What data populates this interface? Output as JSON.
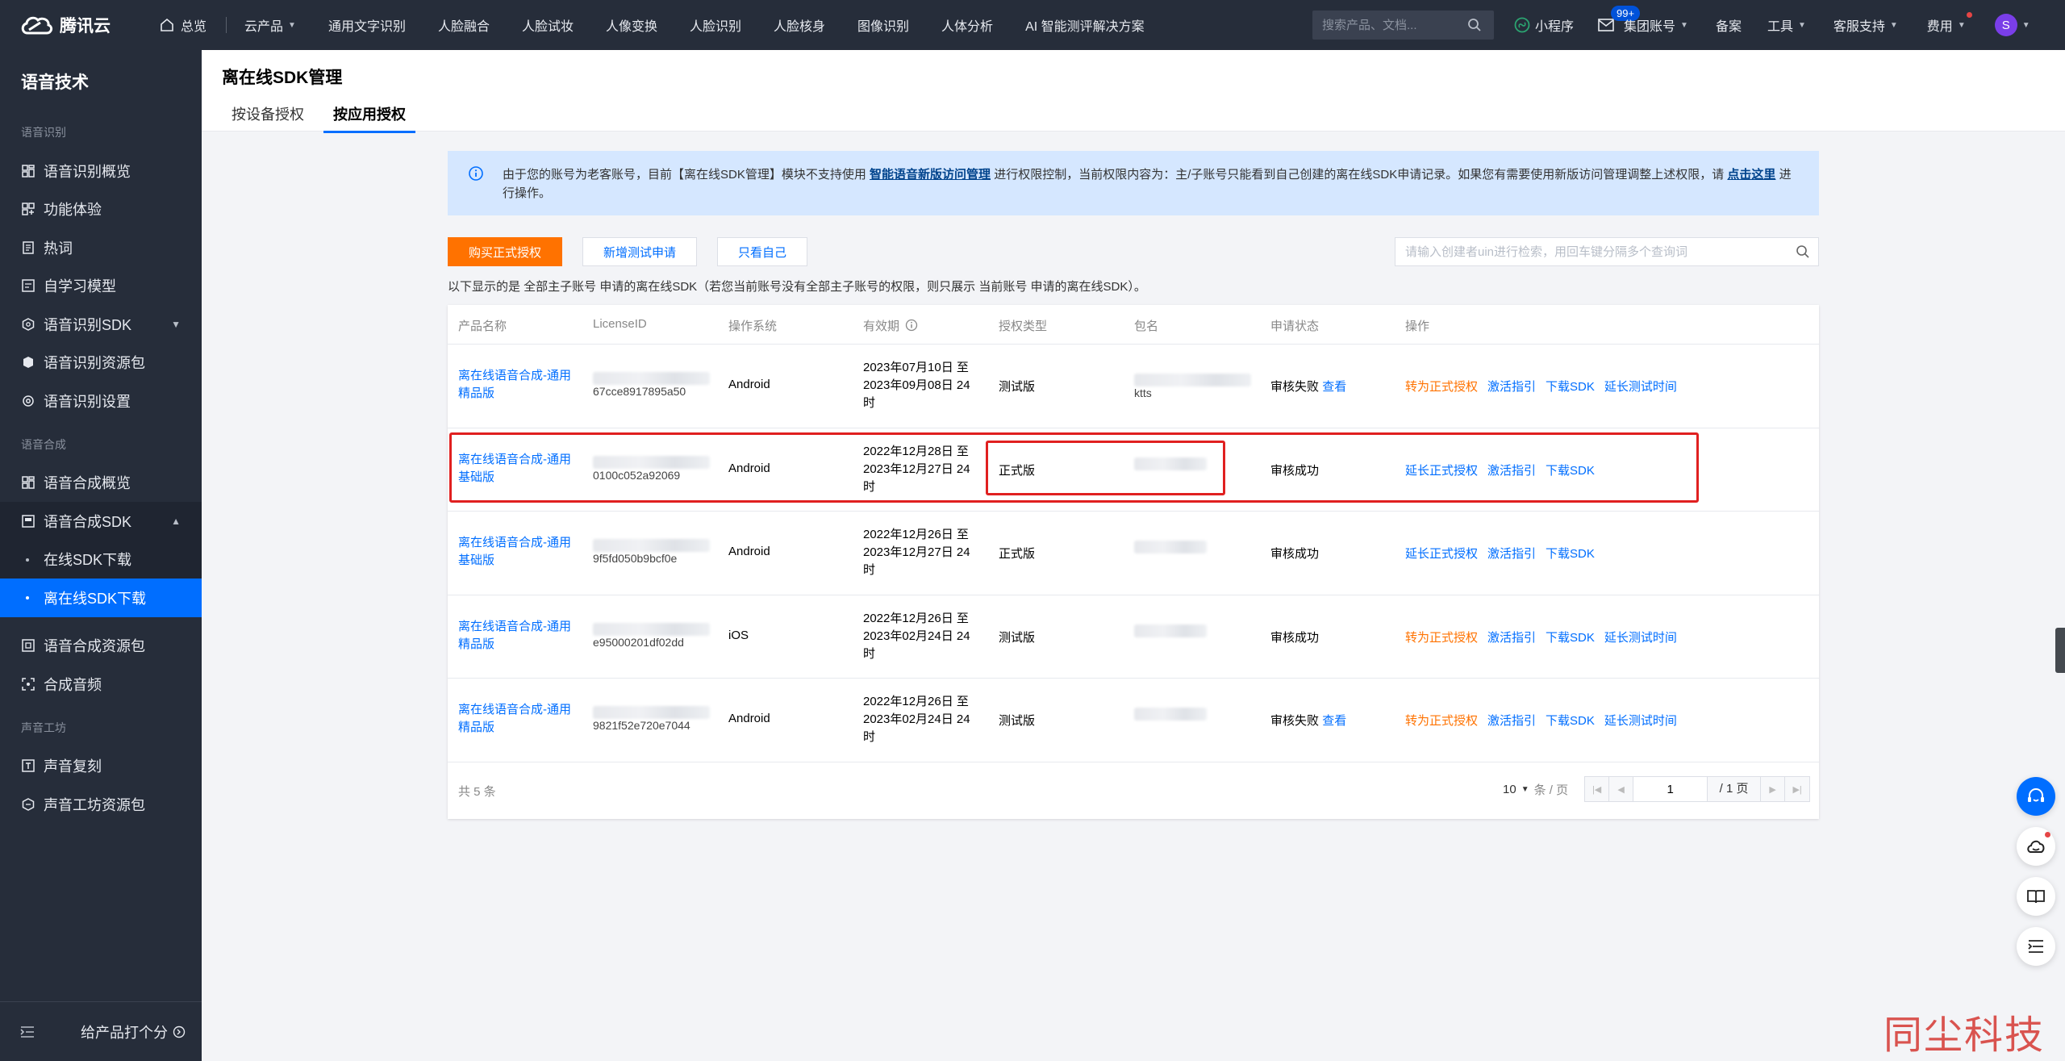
{
  "topbar": {
    "logo": "腾讯云",
    "home": "总览",
    "cloud_products": "云产品",
    "nav": [
      "通用文字识别",
      "人脸融合",
      "人脸试妆",
      "人像变换",
      "人脸识别",
      "人脸核身",
      "图像识别",
      "人体分析",
      "AI 智能测评解决方案"
    ],
    "search_placeholder": "搜索产品、文档...",
    "mini_program": "小程序",
    "mail_badge": "99+",
    "account": "集团账号",
    "beian": "备案",
    "tools": "工具",
    "support": "客服支持",
    "billing": "费用",
    "avatar_letter": "S"
  },
  "sidebar": {
    "title": "语音技术",
    "groups": [
      {
        "label": "语音识别",
        "items": [
          "语音识别概览",
          "功能体验",
          "热词",
          "自学习模型",
          "语音识别SDK",
          "语音识别资源包",
          "语音识别设置"
        ]
      },
      {
        "label": "语音合成",
        "items": [
          "语音合成概览",
          "语音合成SDK"
        ],
        "subitems": [
          "在线SDK下载",
          "离在线SDK下载"
        ],
        "after": [
          "语音合成资源包",
          "合成音频"
        ]
      },
      {
        "label": "声音工坊",
        "items": [
          "声音复刻",
          "声音工坊资源包"
        ]
      }
    ],
    "footer": "给产品打个分"
  },
  "page": {
    "title": "离在线SDK管理",
    "tabs": [
      "按设备授权",
      "按应用授权"
    ],
    "active_tab": 1
  },
  "notice": {
    "text_before": "由于您的账号为老客账号，目前【离在线SDK管理】模块不支持使用",
    "link1": "智能语音新版访问管理",
    "text_middle": "进行权限控制，当前权限内容为：主/子账号只能看到自己创建的离在线SDK申请记录。如果您有需要使用新版访问管理调整上述权限，请",
    "link2": "点击这里",
    "text_after": "进行操作。"
  },
  "toolbar": {
    "buy": "购买正式授权",
    "new_test": "新增测试申请",
    "only_me": "只看自己",
    "filter_placeholder": "请输入创建者uin进行检索，用回车键分隔多个查询词"
  },
  "hint": "以下显示的是 全部主子账号 申请的离在线SDK（若您当前账号没有全部主子账号的权限，则只展示 当前账号 申请的离在线SDK）。",
  "table": {
    "columns": [
      "产品名称",
      "LicenseID",
      "操作系统",
      "有效期",
      "授权类型",
      "包名",
      "申请状态",
      "操作"
    ],
    "rows": [
      {
        "name": "离在线语音合成-通用精品版",
        "license_tail": "67cce8917895a50",
        "os": "Android",
        "validity": "2023年07月10日 至 2023年09月08日 24时",
        "type": "测试版",
        "pkg_tail": "ktts",
        "status": "审核失败",
        "status_link": "查看",
        "ops": [
          {
            "label": "转为正式授权",
            "tone": "orange"
          },
          {
            "label": "激活指引",
            "tone": "blue"
          },
          {
            "label": "下载SDK",
            "tone": "blue"
          },
          {
            "label": "延长测试时间",
            "tone": "blue"
          }
        ]
      },
      {
        "name": "离在线语音合成-通用基础版",
        "license_tail": "0100c052a92069",
        "os": "Android",
        "validity": "2022年12月28日 至 2023年12月27日 24时",
        "type": "正式版",
        "pkg_tail": "",
        "status": "审核成功",
        "status_link": "",
        "ops": [
          {
            "label": "延长正式授权",
            "tone": "blue"
          },
          {
            "label": "激活指引",
            "tone": "blue"
          },
          {
            "label": "下载SDK",
            "tone": "blue"
          }
        ]
      },
      {
        "name": "离在线语音合成-通用基础版",
        "license_tail": "9f5fd050b9bcf0e",
        "os": "Android",
        "validity": "2022年12月26日 至 2023年12月27日 24时",
        "type": "正式版",
        "pkg_tail": "",
        "status": "审核成功",
        "status_link": "",
        "ops": [
          {
            "label": "延长正式授权",
            "tone": "blue"
          },
          {
            "label": "激活指引",
            "tone": "blue"
          },
          {
            "label": "下载SDK",
            "tone": "blue"
          }
        ]
      },
      {
        "name": "离在线语音合成-通用精品版",
        "license_tail": "e95000201df02dd",
        "os": "iOS",
        "validity": "2022年12月26日 至 2023年02月24日 24时",
        "type": "测试版",
        "pkg_tail": "",
        "status": "审核成功",
        "status_link": "",
        "ops": [
          {
            "label": "转为正式授权",
            "tone": "orange"
          },
          {
            "label": "激活指引",
            "tone": "blue"
          },
          {
            "label": "下载SDK",
            "tone": "blue"
          },
          {
            "label": "延长测试时间",
            "tone": "blue"
          }
        ]
      },
      {
        "name": "离在线语音合成-通用精品版",
        "license_tail": "9821f52e720e7044",
        "os": "Android",
        "validity": "2022年12月26日 至 2023年02月24日 24时",
        "type": "测试版",
        "pkg_tail": "",
        "status": "审核失败",
        "status_link": "查看",
        "ops": [
          {
            "label": "转为正式授权",
            "tone": "orange"
          },
          {
            "label": "激活指引",
            "tone": "blue"
          },
          {
            "label": "下载SDK",
            "tone": "blue"
          },
          {
            "label": "延长测试时间",
            "tone": "blue"
          }
        ]
      }
    ]
  },
  "footer": {
    "total": "共 5 条",
    "page_size": "10",
    "per_page": "条 / 页",
    "current_page": "1",
    "total_pages": "/ 1 页"
  },
  "watermark": "同尘科技",
  "colors": {
    "accent": "#006eff",
    "orange": "#ff7200",
    "highlight_box": "#e02020",
    "dark_bg": "#262d3a"
  }
}
